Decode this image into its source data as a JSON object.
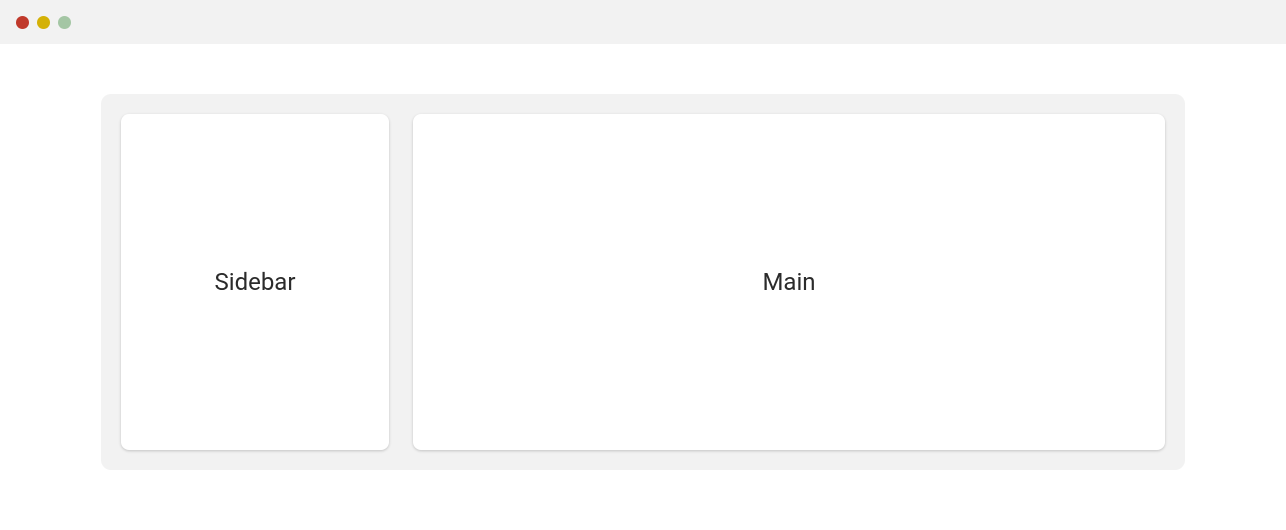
{
  "layout": {
    "sidebar_label": "Sidebar",
    "main_label": "Main"
  }
}
